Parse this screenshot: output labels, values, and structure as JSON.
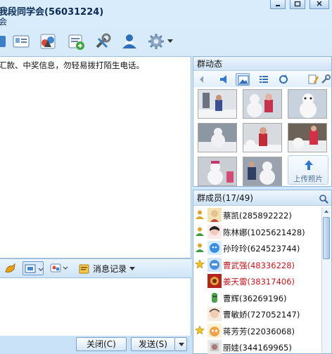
{
  "window": {
    "title": "我段同学会(56031224)",
    "subtitle": "会"
  },
  "chat": {
    "notice": "汇款、中奖信息，勿轻易拨打陌生电话。"
  },
  "input_toolbar": {
    "message_record_label": "消息记录"
  },
  "buttons": {
    "close_label": "关闭(C)",
    "send_label": "发送(S)"
  },
  "group_dynamic": {
    "header": "群动态",
    "upload_label": "上传照片"
  },
  "members": {
    "header": "群成员(17/49)",
    "list": [
      {
        "name": "蔡凯(285892222)",
        "highlight": true,
        "badge": "person"
      },
      {
        "name": "陈林娜(1025621428)",
        "highlight": false,
        "badge": "person"
      },
      {
        "name": "孙玲玲(624523744)",
        "highlight": false,
        "badge": "person"
      },
      {
        "name": "曹武强(48336228)",
        "highlight": true,
        "badge": "star"
      },
      {
        "name": "姜天雷(38317406)",
        "highlight": true,
        "badge": "none"
      },
      {
        "name": "曹辉(36269196)",
        "highlight": false,
        "badge": "none"
      },
      {
        "name": "曹敏娇(727052147)",
        "highlight": false,
        "badge": "none"
      },
      {
        "name": "蒋芳芳(22036068)",
        "highlight": false,
        "badge": "star"
      },
      {
        "name": "丽娃(344169965)",
        "highlight": false,
        "badge": "none"
      }
    ]
  },
  "colors": {
    "highlight_name": "#c0181f",
    "accent": "#4a90d9"
  }
}
